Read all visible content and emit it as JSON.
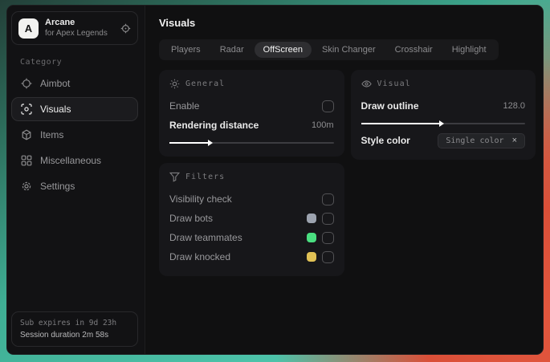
{
  "brand": {
    "logo_letter": "A",
    "title": "Arcane",
    "subtitle": "for Apex Legends"
  },
  "sidebar": {
    "category_label": "Category",
    "items": [
      {
        "label": "Aimbot"
      },
      {
        "label": "Visuals"
      },
      {
        "label": "Items"
      },
      {
        "label": "Miscellaneous"
      },
      {
        "label": "Settings"
      }
    ],
    "footer": {
      "sub_expires": "Sub expires in 9d 23h",
      "session_duration": "Session duration 2m 58s"
    }
  },
  "main": {
    "title": "Visuals",
    "tabs": [
      "Players",
      "Radar",
      "OffScreen",
      "Skin Changer",
      "Crosshair",
      "Highlight"
    ],
    "active_tab": "OffScreen"
  },
  "panels": {
    "general": {
      "title": "General",
      "enable_label": "Enable",
      "rendering_label": "Rendering distance",
      "rendering_value": "100m",
      "rendering_fill": "24%"
    },
    "visual": {
      "title": "Visual",
      "outline_label": "Draw outline",
      "outline_value": "128.0",
      "outline_fill": "48%",
      "style_label": "Style color",
      "style_value": "Single color",
      "chip_close": "×"
    },
    "filters": {
      "title": "Filters",
      "rows": [
        {
          "label": "Visibility check",
          "swatch": null
        },
        {
          "label": "Draw bots",
          "swatch": "#9ca3af"
        },
        {
          "label": "Draw teammates",
          "swatch": "#4ade80"
        },
        {
          "label": "Draw knocked",
          "swatch": "#e0c155"
        }
      ]
    }
  }
}
